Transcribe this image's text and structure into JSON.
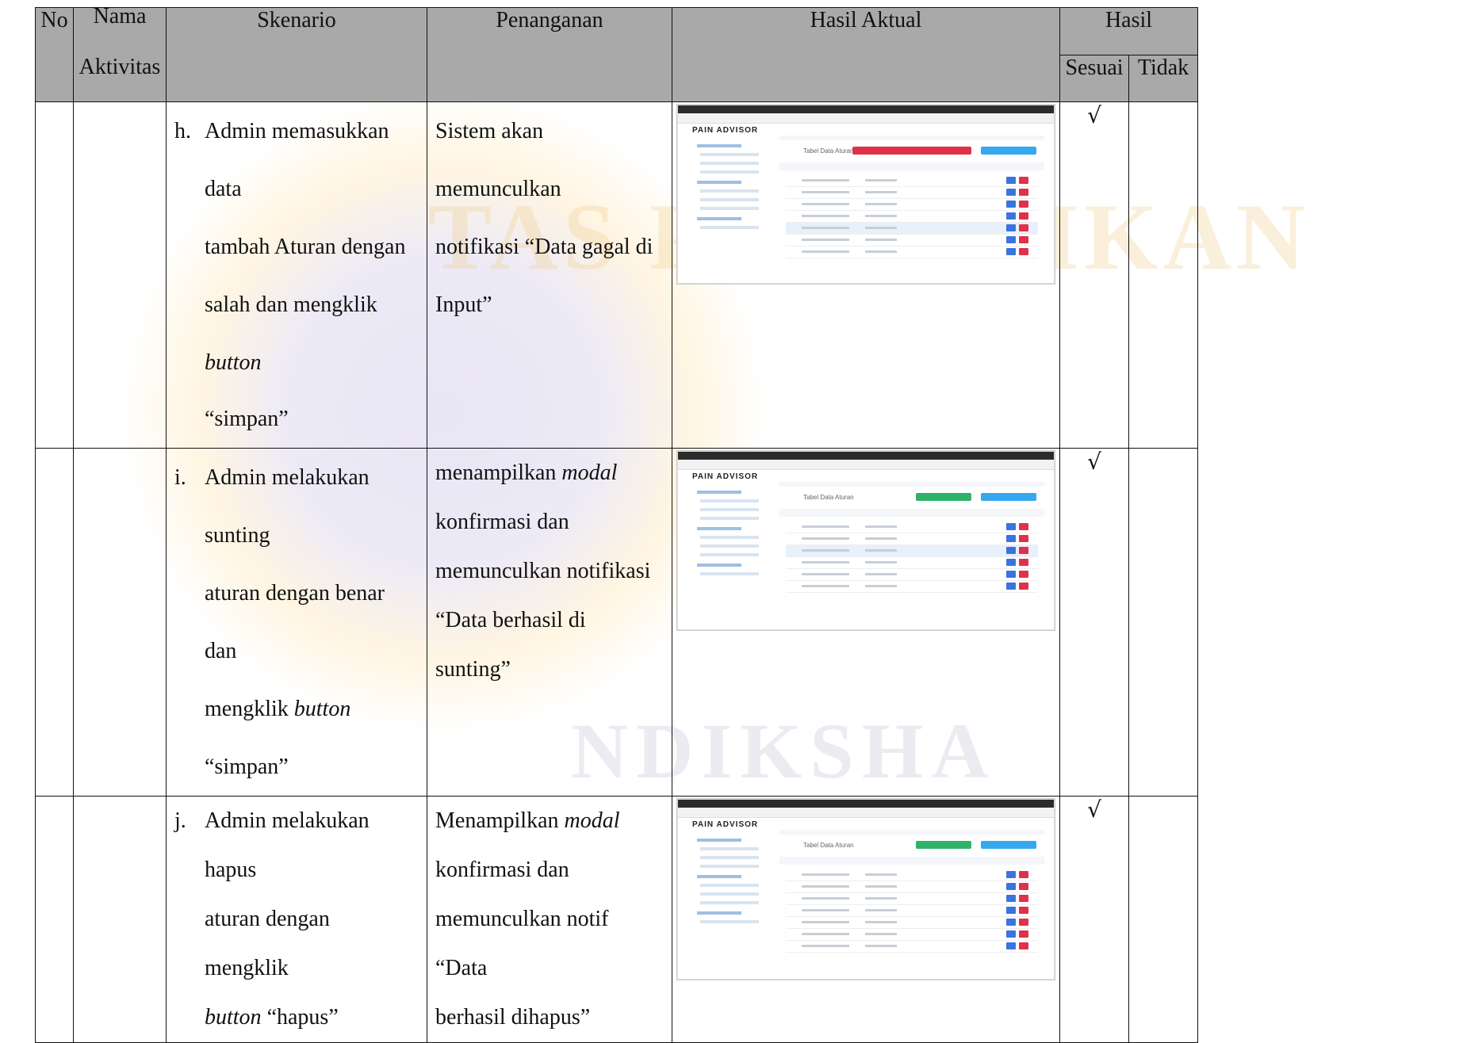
{
  "header": {
    "no": "No",
    "nama": "Nama",
    "aktivitas": "Aktivitas",
    "skenario": "Skenario",
    "penanganan": "Penanganan",
    "hasil_aktual": "Hasil Aktual",
    "hasil": "Hasil",
    "sesuai": "Sesuai",
    "tidak": "Tidak"
  },
  "rows": [
    {
      "letter": "h.",
      "skenario": [
        "Admin memasukkan data",
        "tambah Aturan dengan",
        "salah dan mengklik ",
        "button",
        "“simpan”"
      ],
      "penanganan": [
        "Sistem akan memunculkan",
        "notifikasi “Data gagal di",
        "Input”"
      ],
      "sesuai": "√",
      "alert_color": "#e0314b"
    },
    {
      "letter": "i.",
      "skenario": [
        "Admin melakukan sunting",
        "aturan dengan benar dan",
        "mengklik ",
        "button",
        " “simpan”"
      ],
      "penanganan": [
        "menampilkan ",
        "modal",
        "konfirmasi dan",
        "memunculkan notifikasi",
        "“Data berhasil di sunting”"
      ],
      "sesuai": "√",
      "alert_color": "#2fb36a"
    },
    {
      "letter": "j.",
      "skenario": [
        "Admin melakukan hapus",
        "aturan dengan mengklik",
        "button",
        " “hapus”"
      ],
      "penanganan": [
        "Menampilkan ",
        "modal",
        "konfirmasi dan",
        "memunculkan notif “Data",
        "berhasil dihapus”"
      ],
      "sesuai": "√",
      "alert_color": "#2fb36a"
    }
  ],
  "screenshot": {
    "brand": "PAIN ADVISOR",
    "page_title": "Tabel Data Aturan"
  },
  "watermark": {
    "top": "TAS PENDIDIKAN",
    "bottom": "NDIKSHA"
  }
}
